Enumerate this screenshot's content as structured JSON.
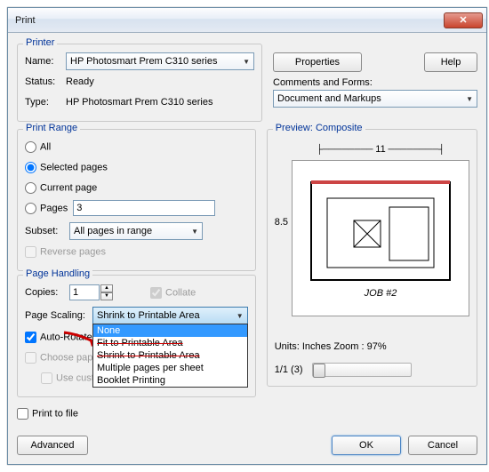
{
  "title": "Print",
  "printer": {
    "legend": "Printer",
    "name_label": "Name:",
    "name_value": "HP Photosmart Prem C310 series",
    "status_label": "Status:",
    "status_value": "Ready",
    "type_label": "Type:",
    "type_value": "HP Photosmart Prem C310 series"
  },
  "buttons": {
    "properties": "Properties",
    "help": "Help",
    "advanced": "Advanced",
    "ok": "OK",
    "cancel": "Cancel"
  },
  "comments": {
    "label": "Comments and Forms:",
    "value": "Document and Markups"
  },
  "range": {
    "legend": "Print Range",
    "all": "All",
    "selected_pages": "Selected pages",
    "current_page": "Current page",
    "pages": "Pages",
    "pages_value": "3",
    "subset_label": "Subset:",
    "subset_value": "All pages in range",
    "reverse": "Reverse pages"
  },
  "handling": {
    "legend": "Page Handling",
    "copies_label": "Copies:",
    "copies_value": "1",
    "collate": "Collate",
    "scaling_label": "Page Scaling:",
    "scaling_value": "Shrink to Printable Area",
    "scaling_options": {
      "none": "None",
      "fit": "Fit to Printable Area",
      "shrink": "Shrink to Printable Area",
      "multiple": "Multiple pages per sheet",
      "booklet": "Booklet Printing"
    },
    "auto_rotate": "Auto-Rotate",
    "choose_paper": "Choose pape",
    "custom_paper": "Use custom paper size when needed"
  },
  "print_to_file": "Print to file",
  "preview": {
    "label": "Preview: Composite",
    "width_dim": "11",
    "height_dim": "8.5",
    "job_label": "JOB #2",
    "units": "Units: Inches Zoom :   97%",
    "page_indicator": "1/1 (3)"
  }
}
